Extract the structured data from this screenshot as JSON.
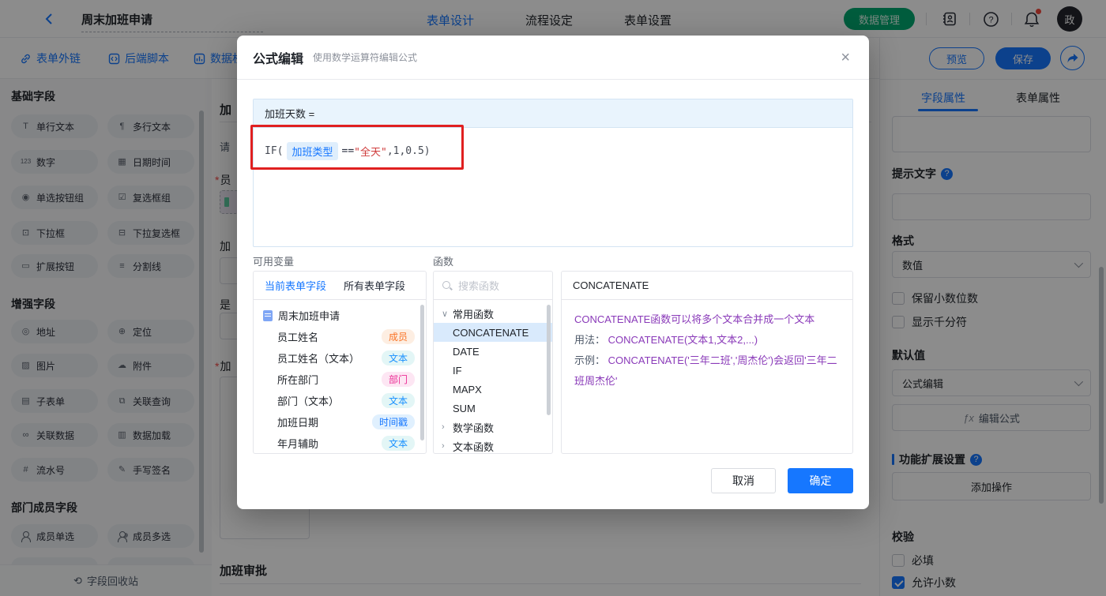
{
  "colors": {
    "accent_blue": "#1677ff",
    "green_pill": "#00a870",
    "annotation_red": "#e02020",
    "string_red": "#cf3b3b",
    "desc_purple": "#8a3ab9"
  },
  "header": {
    "title": "周末加班申请",
    "tabs": [
      {
        "label": "表单设计",
        "active": true
      },
      {
        "label": "流程设定",
        "active": false
      },
      {
        "label": "表单设置",
        "active": false
      }
    ],
    "data_manage": "数据管理",
    "avatar": "政"
  },
  "toolbar": {
    "links": [
      {
        "label": "表单外链"
      },
      {
        "label": "后端脚本"
      },
      {
        "label": "数据权"
      }
    ]
  },
  "left_sidebar": {
    "sections": [
      {
        "title": "基础字段",
        "items": [
          {
            "label": "单行文本",
            "glyph": "T"
          },
          {
            "label": "多行文本",
            "glyph": "¶"
          },
          {
            "label": "数字",
            "glyph": "123"
          },
          {
            "label": "日期时间",
            "glyph": "▦"
          },
          {
            "label": "单选按钮组",
            "glyph": "◉"
          },
          {
            "label": "复选框组",
            "glyph": "☑"
          },
          {
            "label": "下拉框",
            "glyph": "⊡"
          },
          {
            "label": "下拉复选框",
            "glyph": "⊟"
          },
          {
            "label": "扩展按钮",
            "glyph": "▭"
          },
          {
            "label": "分割线",
            "glyph": "≡"
          }
        ]
      },
      {
        "title": "增强字段",
        "items": [
          {
            "label": "地址",
            "glyph": "◎"
          },
          {
            "label": "定位",
            "glyph": "⊕"
          },
          {
            "label": "图片",
            "glyph": "▨"
          },
          {
            "label": "附件",
            "glyph": "☁"
          },
          {
            "label": "子表单",
            "glyph": "▤"
          },
          {
            "label": "关联查询",
            "glyph": "⧉"
          },
          {
            "label": "关联数据",
            "glyph": "∞"
          },
          {
            "label": "数据加载",
            "glyph": "▥"
          },
          {
            "label": "流水号",
            "glyph": "#"
          },
          {
            "label": "手写签名",
            "glyph": "✎"
          }
        ]
      },
      {
        "title": "部门成员字段",
        "items": [
          {
            "label": "成员单选",
            "glyph": ""
          },
          {
            "label": "成员多选",
            "glyph": ""
          }
        ]
      }
    ],
    "footer": {
      "label": "字段回收站",
      "glyph": "⟲"
    }
  },
  "canvas": {
    "title_char": "加",
    "hint_char": "请",
    "req_member": {
      "star": "*",
      "text": "员"
    },
    "label_a": "加",
    "label_b": "是",
    "req_overtime": {
      "star": "*",
      "text": "加"
    },
    "approval_title": "加班审批"
  },
  "modal": {
    "title": "公式编辑",
    "subtitle": "使用数学运算符编辑公式",
    "close_glyph": "×",
    "formula": {
      "target": "加班天数 =",
      "prefix": "IF(",
      "token": "加班类型",
      "operator": "==",
      "string": "\"全天\"",
      "suffix": ",1,0.5)"
    },
    "variables": {
      "label": "可用变量",
      "tabs": [
        {
          "label": "当前表单字段",
          "active": true
        },
        {
          "label": "所有表单字段",
          "active": false
        }
      ],
      "root": "周末加班申请",
      "fields": [
        {
          "name": "员工姓名",
          "type": "成员"
        },
        {
          "name": "员工姓名（文本）",
          "type": "文本"
        },
        {
          "name": "所在部门",
          "type": "部门"
        },
        {
          "name": "部门（文本）",
          "type": "文本"
        },
        {
          "name": "加班日期",
          "type": "时间戳"
        },
        {
          "name": "年月辅助",
          "type": "文本"
        }
      ]
    },
    "functions": {
      "label": "函数",
      "search_placeholder": "搜索函数",
      "group_common": {
        "name": "常用函数",
        "chevron": "∨"
      },
      "items": [
        "CONCATENATE",
        "DATE",
        "IF",
        "MAPX",
        "SUM"
      ],
      "selected_item": "CONCATENATE",
      "group_math": {
        "name": "数学函数",
        "chevron": "›"
      },
      "group_text": {
        "name": "文本函数",
        "chevron": "›"
      }
    },
    "description": {
      "title": "CONCATENATE",
      "line1": "CONCATENATE函数可以将多个文本合并成一个文本",
      "usage_label": "用法：",
      "usage": "CONCATENATE(文本1,文本2,...)",
      "example_label": "示例：",
      "example": "CONCATENATE('三年二班','周杰伦')会返回'三年二班周杰伦'"
    },
    "cancel": "取消",
    "confirm": "确定"
  },
  "right_panel": {
    "preview": "预览",
    "save": "保存",
    "tabs": [
      {
        "label": "字段属性",
        "active": true
      },
      {
        "label": "表单属性",
        "active": false
      }
    ],
    "hint_label": "提示文字",
    "help_glyph": "?",
    "format_label": "格式",
    "format_value": "数值",
    "opt_decimal_digits": "保留小数位数",
    "opt_thousands": "显示千分符",
    "default_label": "默认值",
    "default_value": "公式编辑",
    "fx_glyph": "ƒx",
    "edit_formula": "编辑公式",
    "ext_label": "功能扩展设置",
    "add_action": "添加操作",
    "validate_label": "校验",
    "opt_required": "必填",
    "opt_allow_decimal": "允许小数"
  }
}
